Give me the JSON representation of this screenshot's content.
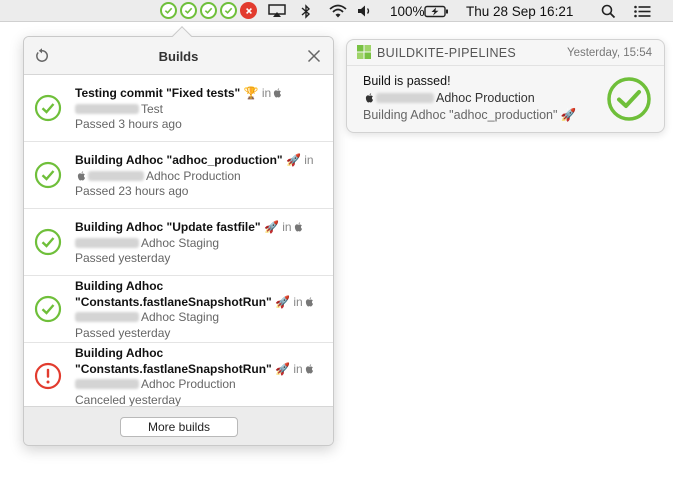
{
  "menubar": {
    "status_icons": [
      "check-icon",
      "check-icon",
      "check-icon",
      "check-icon",
      "x-icon"
    ],
    "battery": "100%",
    "datetime": "Thu 28 Sep  16:21"
  },
  "popover": {
    "title": "Builds",
    "more_label": "More builds",
    "builds": [
      {
        "status": "passed",
        "title": "Testing commit \"Fixed tests\"",
        "emoji": "🏆",
        "in": "in",
        "pipeline": "Test",
        "when": "Passed 3 hours ago"
      },
      {
        "status": "passed",
        "title": "Building Adhoc \"adhoc_production\"",
        "emoji": "🚀",
        "in": "in",
        "pipeline": "Adhoc Production",
        "when": "Passed 23 hours ago"
      },
      {
        "status": "passed",
        "title": "Building Adhoc \"Update fastfile\"",
        "emoji": "🚀",
        "in": "in",
        "pipeline": "Adhoc Staging",
        "when": "Passed yesterday"
      },
      {
        "status": "passed",
        "title": "Building Adhoc \"Constants.fastlaneSnapshotRun\"",
        "emoji": "🚀",
        "in": "in",
        "pipeline": "Adhoc Staging",
        "when": "Passed yesterday"
      },
      {
        "status": "canceled",
        "title": "Building Adhoc \"Constants.fastlaneSnapshotRun\"",
        "emoji": "🚀",
        "in": "in",
        "pipeline": "Adhoc Production",
        "when": "Canceled yesterday"
      }
    ]
  },
  "notification": {
    "app_name": "BUILDKITE-PIPELINES",
    "time": "Yesterday, 15:54",
    "title": "Build is passed!",
    "pipeline": "Adhoc Production",
    "message": "Building Adhoc \"adhoc_production\"",
    "emoji": "🚀"
  },
  "colors": {
    "passed": "#6fbf3a",
    "failed": "#e23b2e"
  }
}
